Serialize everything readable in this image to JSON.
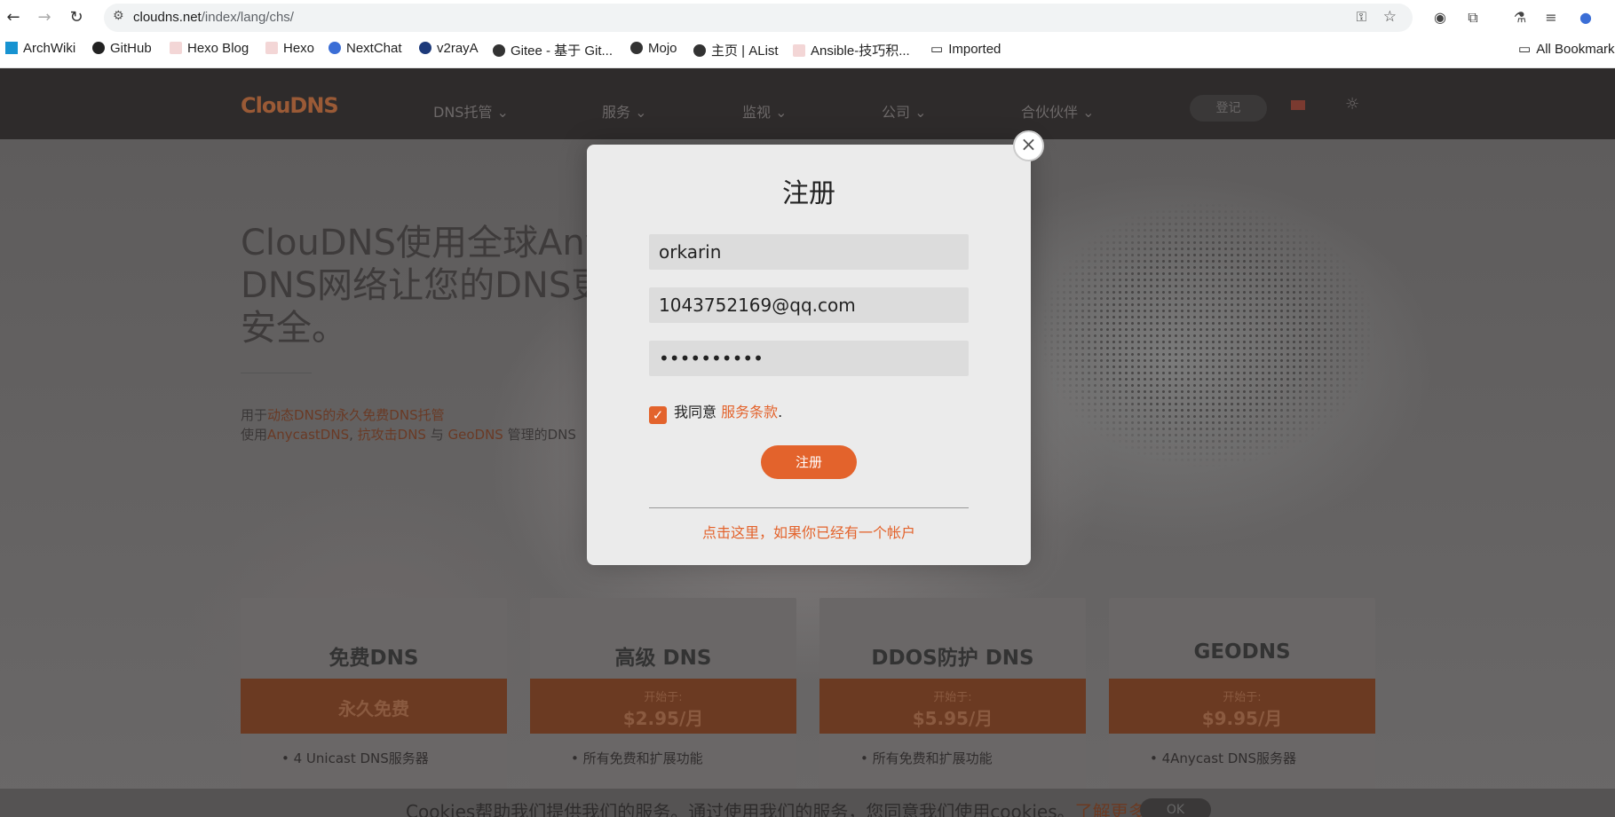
{
  "browser": {
    "url_host": "cloudns.net",
    "url_path": "/index/lang/chs/",
    "bookmarks": [
      "ArchWiki",
      "GitHub",
      "Hexo Blog",
      "Hexo",
      "NextChat",
      "v2rayA",
      "Gitee - 基于 Git...",
      "Mojo",
      "主页 | AList",
      "Ansible-技巧积...",
      "Imported"
    ],
    "all_bookmarks": "All Bookmarks"
  },
  "site": {
    "logo": "ClouDNS",
    "menu": [
      "DNS托管 ⌄",
      "服务 ⌄",
      "监视 ⌄",
      "公司 ⌄",
      "合伙伙伴 ⌄"
    ],
    "login": "登记",
    "hero_title": "ClouDNS使用全球Any DNS网络让您的DNS更 更安全。",
    "hero_line1_a": "用于",
    "hero_line1_b": "动态DNS的永久免费DNS托管",
    "hero_line2_a": "使用",
    "hero_line2_b": "AnycastDNS",
    "hero_line2_c": ", ",
    "hero_line2_d": "抗攻击DNS",
    "hero_line2_e": " 与 ",
    "hero_line2_f": "GeoDNS",
    "hero_line2_g": " 管理的DNS"
  },
  "cards": [
    {
      "title": "免费DNS",
      "band_small": "",
      "band_big": "永久免费",
      "feature": "4 Unicast DNS服务器"
    },
    {
      "title": "高级 DNS",
      "band_small": "开始于:",
      "band_big": "$2.95/月",
      "feature": "所有免费和扩展功能"
    },
    {
      "title": "DDOS防护 DNS",
      "band_small": "开始于:",
      "band_big": "$5.95/月",
      "feature": "所有免费和扩展功能"
    },
    {
      "title": "GEODNS",
      "band_small": "开始于:",
      "band_big": "$9.95/月",
      "feature": "4Anycast DNS服务器"
    }
  ],
  "cookie": {
    "text": "Cookies帮助我们提供我们的服务。通过使用我们的服务，您同意我们使用cookies。",
    "link": "了解更多",
    "ok": "OK"
  },
  "modal": {
    "title": "注册",
    "username": "orkarin",
    "email": "1043752169@qq.com",
    "password_mask": "••••••••••",
    "agree_text": "我同意 ",
    "terms": "服务条款",
    "terms_dot": ".",
    "submit": "注册",
    "login_link": "点击这里，如果你已经有一个帐户",
    "close": "×"
  },
  "colors": {
    "accent": "#e3632c"
  }
}
